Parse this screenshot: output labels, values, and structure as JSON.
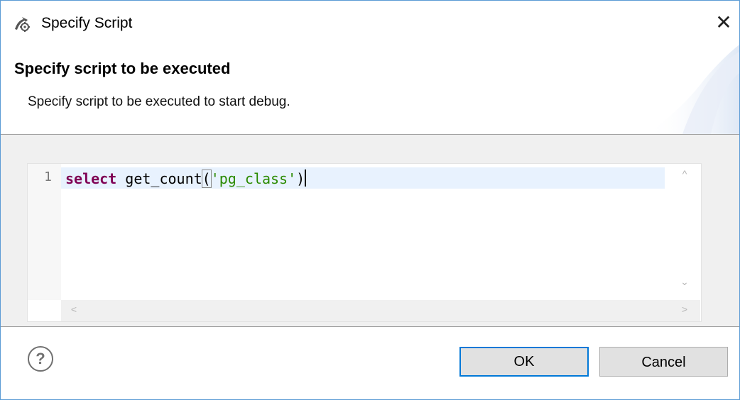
{
  "window": {
    "title": "Specify Script",
    "app_icon": "gear-wrench-icon",
    "close_icon": "close-icon",
    "close_glyph": "✕"
  },
  "banner": {
    "heading": "Specify script to be executed",
    "message": "Specify script to be executed to start debug."
  },
  "editor": {
    "line_numbers": [
      "1"
    ],
    "code": {
      "keyword": "select",
      "func": " get_count",
      "open_paren": "(",
      "string": "'pg_class'",
      "close_paren": ")"
    },
    "current_line_color": "#e8f2fe",
    "keyword_color": "#7f0055",
    "string_color": "#2a8a00"
  },
  "scrollbars": {
    "up_glyph": "^",
    "down_glyph": "⌄",
    "left_glyph": "<",
    "right_glyph": ">"
  },
  "footer": {
    "help_icon": "help-icon",
    "help_glyph": "?",
    "ok_label": "OK",
    "cancel_label": "Cancel",
    "default_button_color": "#0078d7"
  }
}
